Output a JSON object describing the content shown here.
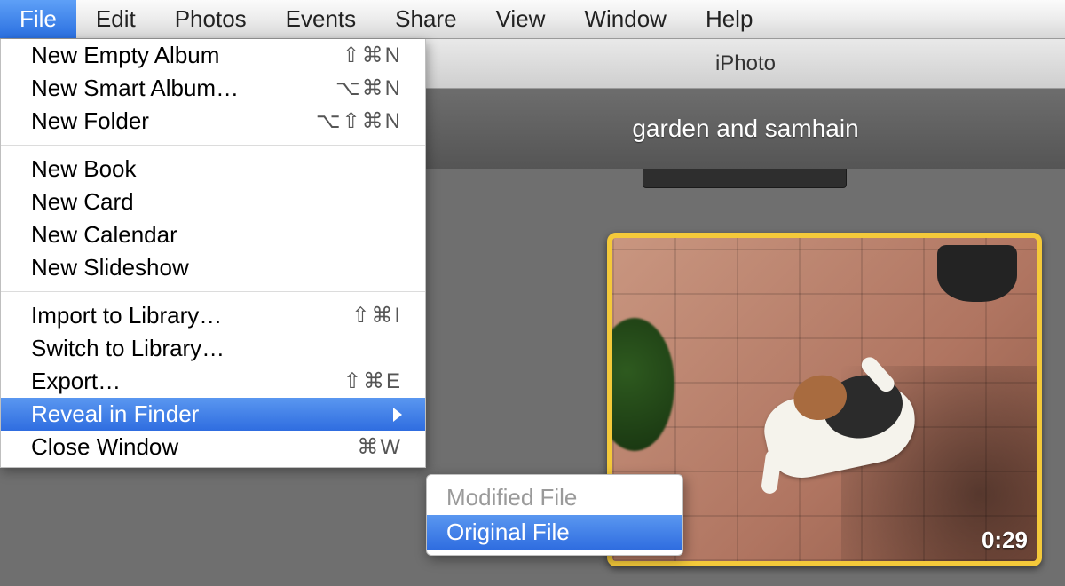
{
  "menubar": {
    "items": [
      {
        "label": "File",
        "active": true
      },
      {
        "label": "Edit"
      },
      {
        "label": "Photos"
      },
      {
        "label": "Events"
      },
      {
        "label": "Share"
      },
      {
        "label": "View"
      },
      {
        "label": "Window"
      },
      {
        "label": "Help"
      }
    ]
  },
  "window": {
    "title": "iPhoto",
    "event_title": "garden and samhain"
  },
  "file_menu": {
    "new_empty_album": {
      "label": "New Empty Album",
      "shortcut": "⇧⌘N"
    },
    "new_smart_album": {
      "label": "New Smart Album…",
      "shortcut": "⌥⌘N"
    },
    "new_folder": {
      "label": "New Folder",
      "shortcut": "⌥⇧⌘N"
    },
    "new_book": {
      "label": "New Book"
    },
    "new_card": {
      "label": "New Card"
    },
    "new_calendar": {
      "label": "New Calendar"
    },
    "new_slideshow": {
      "label": "New Slideshow"
    },
    "import_to_library": {
      "label": "Import to Library…",
      "shortcut": "⇧⌘I"
    },
    "switch_to_library": {
      "label": "Switch to Library…"
    },
    "export": {
      "label": "Export…",
      "shortcut": "⇧⌘E"
    },
    "reveal_in_finder": {
      "label": "Reveal in Finder"
    },
    "close_window": {
      "label": "Close Window",
      "shortcut": "⌘W"
    }
  },
  "reveal_submenu": {
    "modified_file": {
      "label": "Modified File",
      "enabled": false
    },
    "original_file": {
      "label": "Original File",
      "enabled": true,
      "highlighted": true
    }
  },
  "thumbnail": {
    "duration": "0:29",
    "selected": true
  }
}
